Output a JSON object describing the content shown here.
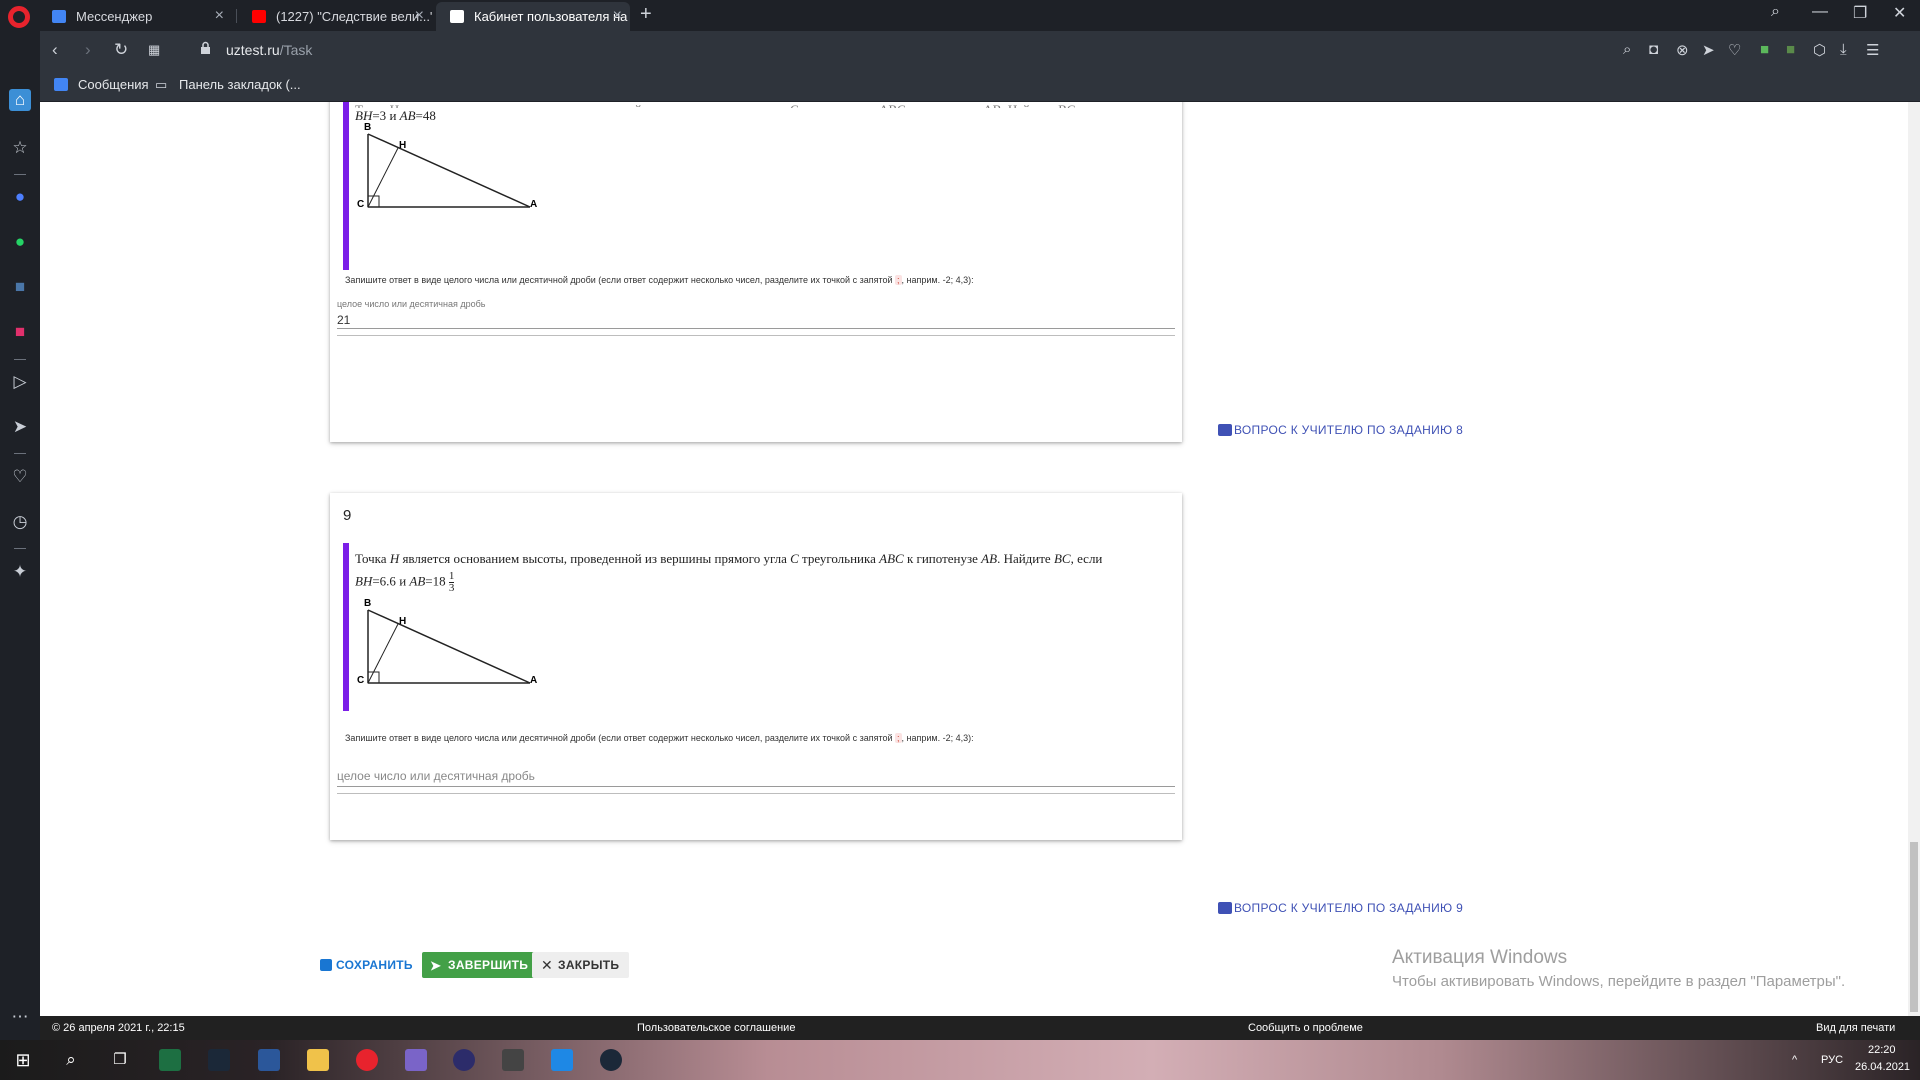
{
  "browser": {
    "tabs": [
      {
        "title": "Мессенджер",
        "color": "#4285f4"
      },
      {
        "title": "(1227) \"Следствие вели...\"",
        "color": "#ff0000"
      },
      {
        "title": "Кабинет пользователя на",
        "color": "#ffffff"
      }
    ],
    "new_tab": "+",
    "url_domain": "uztest.ru",
    "url_path": "/Task",
    "bookmarks": [
      {
        "label": "Сообщения"
      },
      {
        "label": "Панель закладок (..."
      }
    ]
  },
  "task8": {
    "question_line1_cut": "Точка H является основанием высоты, проведенной из вершины прямого угла C треугольника ABC к гипотенузе AB. Найдите BC, если",
    "cond_bh": "BH",
    "cond_bh_val": "=3",
    "cond_and": " и ",
    "cond_ab": "AB",
    "cond_ab_val": "=48",
    "instruction": "Запишите ответ в виде целого числа или десятичной дроби (если ответ содержит несколько чисел, разделите их точкой с запятой",
    "instruction_sep": ";",
    "instruction_tail": ", наприм. -2; 4,3):",
    "field_label": "целое число или десятичная дробь",
    "answer": "21",
    "ask_teacher": "ВОПРОС К УЧИТЕЛЮ ПО ЗАДАНИЮ 8"
  },
  "task9": {
    "number": "9",
    "q_pre": "Точка ",
    "q_h": "H",
    "q_mid1": " является основанием высоты, проведенной из вершины прямого угла ",
    "q_c": "C",
    "q_mid2": " треугольника ",
    "q_abc": "ABC",
    "q_mid3": " к гипотенузе ",
    "q_ab": "AB",
    "q_mid4": ". Найдите ",
    "q_bc": "BC",
    "q_end": ", если",
    "cond_bh": "BH",
    "cond_bh_val": "=6.6",
    "cond_and": " и ",
    "cond_ab": "AB",
    "cond_ab_val": "=18",
    "frac_num": "1",
    "frac_den": "3",
    "instruction": "Запишите ответ в виде целого числа или десятичной дроби (если ответ содержит несколько чисел, разделите их точкой с запятой",
    "instruction_sep": ";",
    "instruction_tail": ", наприм. -2; 4,3):",
    "placeholder": "целое число или десятичная дробь",
    "ask_teacher": "ВОПРОС К УЧИТЕЛЮ ПО ЗАДАНИЮ 9"
  },
  "figure": {
    "B": "B",
    "H": "H",
    "C": "C",
    "A": "A"
  },
  "actions": {
    "save": "СОХРАНИТЬ",
    "finish": "ЗАВЕРШИТЬ",
    "close": "ЗАКРЫТЬ"
  },
  "activation": {
    "title": "Активация Windows",
    "subtitle": "Чтобы активировать Windows, перейдите в раздел \"Параметры\"."
  },
  "footer": {
    "copyright": "© 26 апреля 2021 г., 22:15",
    "agreement": "Пользовательское соглашение",
    "report": "Сообщить о проблеме",
    "print": "Вид для печати"
  },
  "taskbar": {
    "lang": "РУС",
    "time": "22:20",
    "date": "26.04.2021"
  },
  "colors": {
    "accent_bar": "#7b1ee8",
    "finish_green": "#43a047",
    "link_blue": "#3f51b5"
  }
}
